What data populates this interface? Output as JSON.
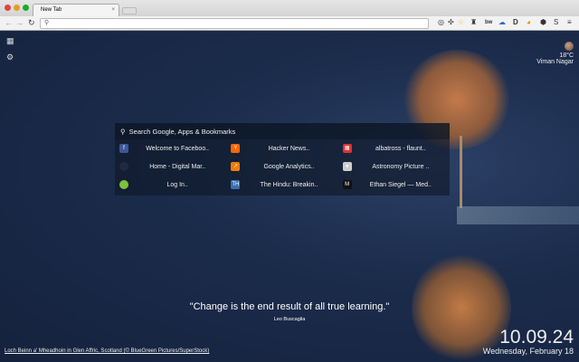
{
  "browser": {
    "tab_title": "New Tab",
    "tab_close": "×",
    "url": ""
  },
  "weather": {
    "temp": "18°C",
    "location": "Viman Nagar"
  },
  "search": {
    "placeholder": "Search Google, Apps & Bookmarks"
  },
  "shortcuts": [
    {
      "label": "Welcome to Faceboo..",
      "icon": "f",
      "color": "#3b5998"
    },
    {
      "label": "Hacker News..",
      "icon": "Y",
      "color": "#ff6600"
    },
    {
      "label": "albatross - flaunt..",
      "icon": "▦",
      "color": "#d33"
    },
    {
      "label": "Home - Digital Mar..",
      "icon": "",
      "color": "#1e2a40"
    },
    {
      "label": "Google Analytics..",
      "icon": "↗",
      "color": "#f57c00"
    },
    {
      "label": "Astronomy Picture ..",
      "icon": "●",
      "color": "#ccc"
    },
    {
      "label": "Log In..",
      "icon": "",
      "color": "#7cc23a"
    },
    {
      "label": "The Hindu: Breakin..",
      "icon": "TH",
      "color": "#3a6fb0"
    },
    {
      "label": "Ethan Siegel — Med..",
      "icon": "M",
      "color": "#111"
    }
  ],
  "quote": {
    "text": "\"Change is the end result of all true learning.\"",
    "author": "Leo Buscaglia"
  },
  "credit": "Loch Beinn a' Mheadhoin in Glen Affric, Scotland (© BlueGreen Pictures/SuperStock)",
  "clock": {
    "time": "10.09.24",
    "date": "Wednesday, February 18"
  }
}
